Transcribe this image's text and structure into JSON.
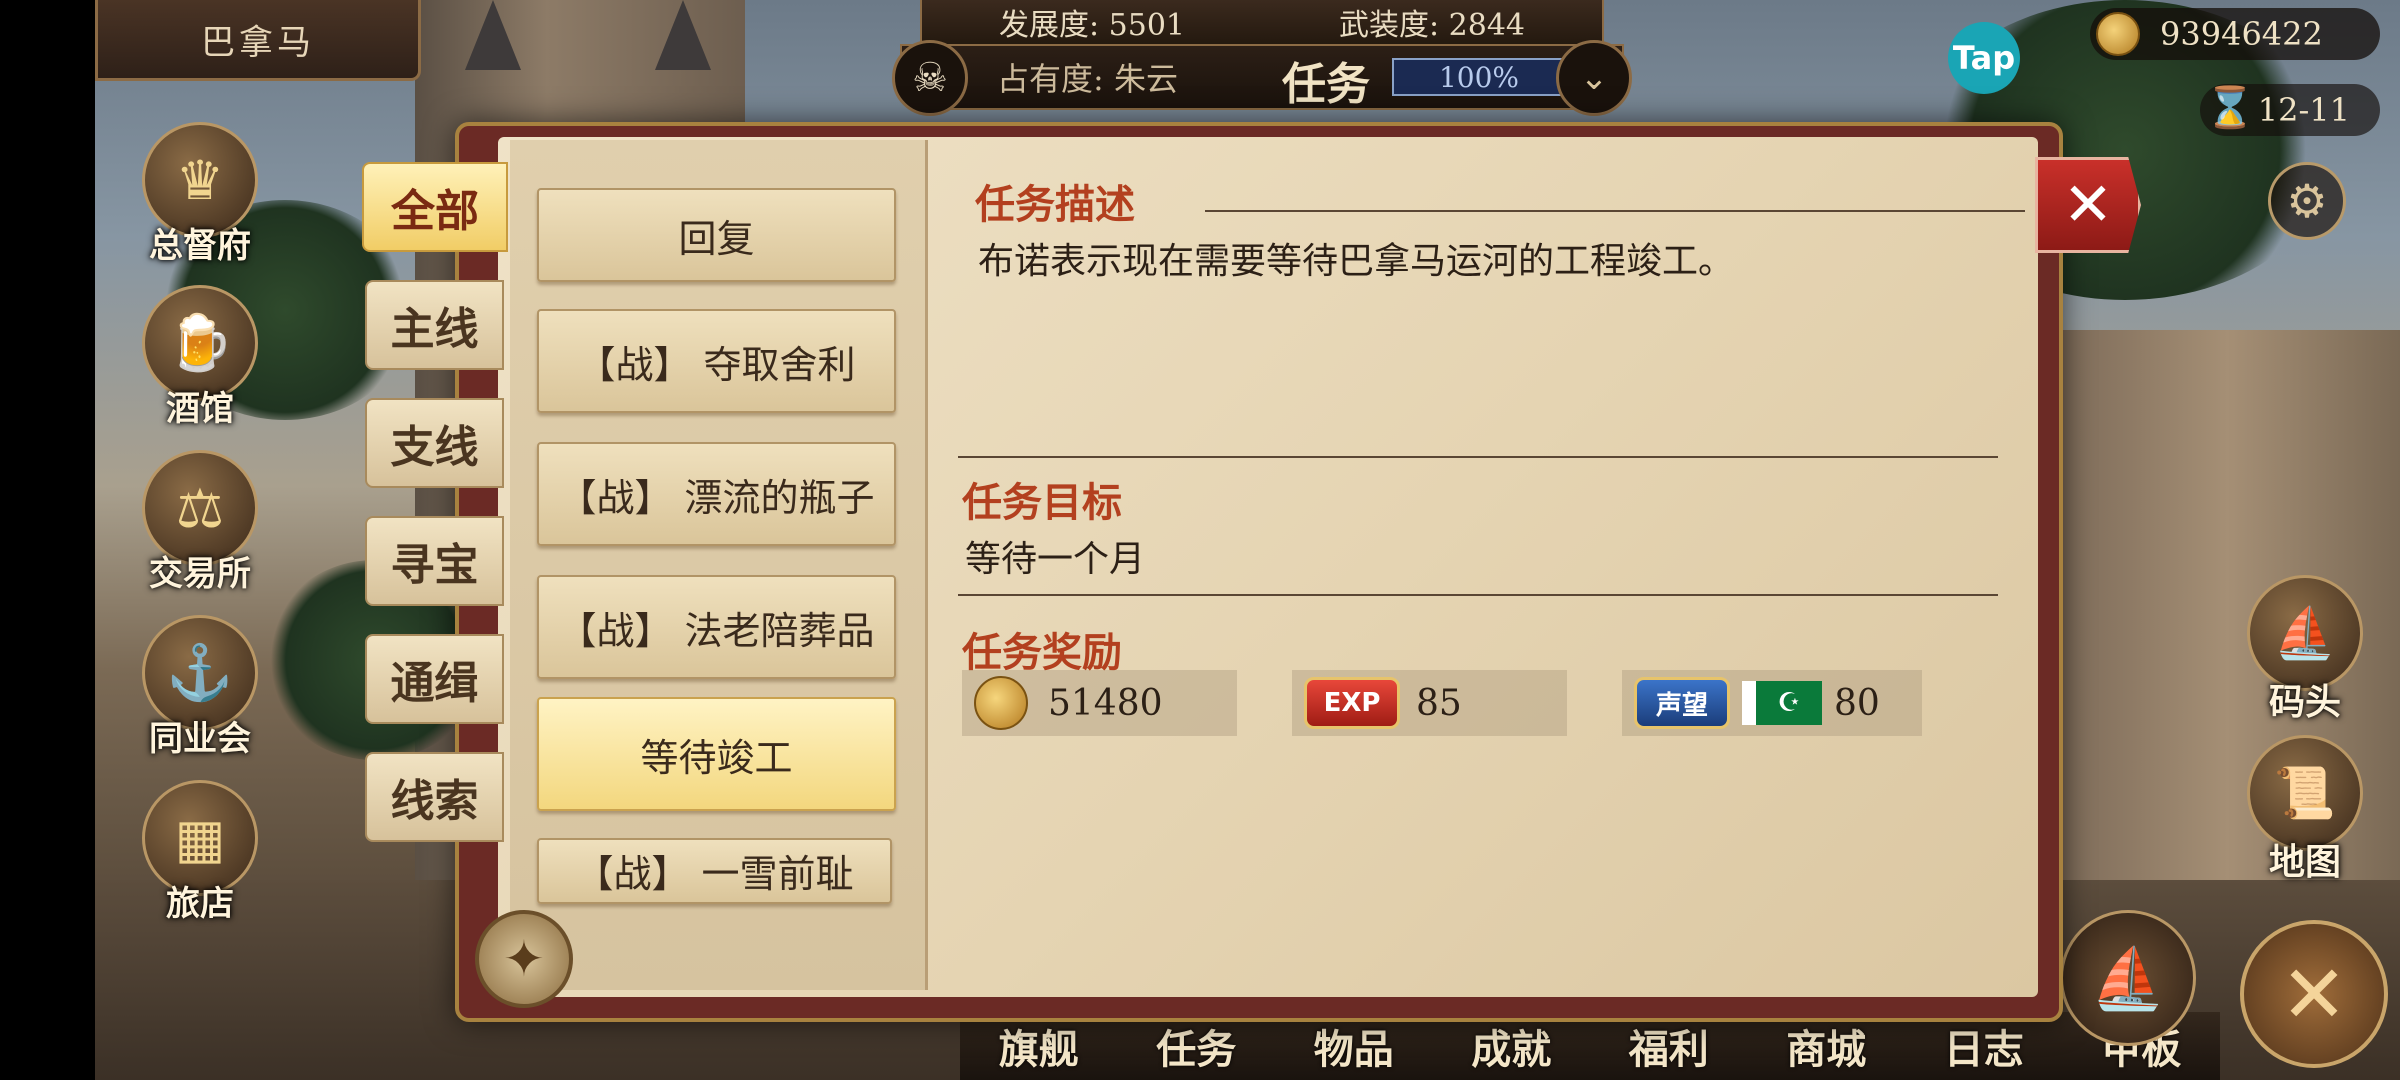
{
  "city": {
    "name": "巴拿马"
  },
  "top_status": {
    "development_label": "发展度: 5501",
    "armament_label": "武装度: 2844",
    "occupation_label": "占有度: 朱云",
    "screen_title": "任务",
    "progress": "100%"
  },
  "resources": {
    "gold": "93946422",
    "date": "12-11"
  },
  "left_nav": [
    {
      "label": "总督府",
      "icon": "crown-icon"
    },
    {
      "label": "酒馆",
      "icon": "beer-mug-icon"
    },
    {
      "label": "交易所",
      "icon": "scales-icon"
    },
    {
      "label": "同业会",
      "icon": "anchor-shield-icon"
    },
    {
      "label": "旅店",
      "icon": "bed-icon"
    }
  ],
  "right_nav": [
    {
      "label": "码头",
      "icon": "pier-icon"
    },
    {
      "label": "地图",
      "icon": "map-scroll-icon"
    }
  ],
  "bottom_nav": [
    "旗舰",
    "任务",
    "物品",
    "成就",
    "福利",
    "商城",
    "日志",
    "甲板"
  ],
  "categories": [
    {
      "label": "全部",
      "active": true
    },
    {
      "label": "主线",
      "active": false
    },
    {
      "label": "支线",
      "active": false
    },
    {
      "label": "寻宝",
      "active": false
    },
    {
      "label": "通缉",
      "active": false
    },
    {
      "label": "线索",
      "active": false
    }
  ],
  "quests": [
    {
      "label": "回复",
      "active": false
    },
    {
      "label": "【战】 夺取舍利",
      "active": false
    },
    {
      "label": "【战】 漂流的瓶子",
      "active": false
    },
    {
      "label": "【战】 法老陪葬品",
      "active": false
    },
    {
      "label": "等待竣工",
      "active": true
    },
    {
      "label": "【战】 一雪前耻",
      "active": false
    }
  ],
  "detail": {
    "description_title": "任务描述",
    "description_text": "布诺表示现在需要等待巴拿马运河的工程竣工。",
    "objective_title": "任务目标",
    "objective_text": "等待一个月",
    "reward_title": "任务奖励",
    "rewards": {
      "gold": "51480",
      "exp_label": "EXP",
      "exp": "85",
      "fame_label": "声望",
      "fame": "80"
    }
  },
  "brand": {
    "tap": "Tap"
  },
  "colors": {
    "accent_red": "#b3401f",
    "close_red": "#c9302a",
    "paper": "#e5d4b2"
  }
}
